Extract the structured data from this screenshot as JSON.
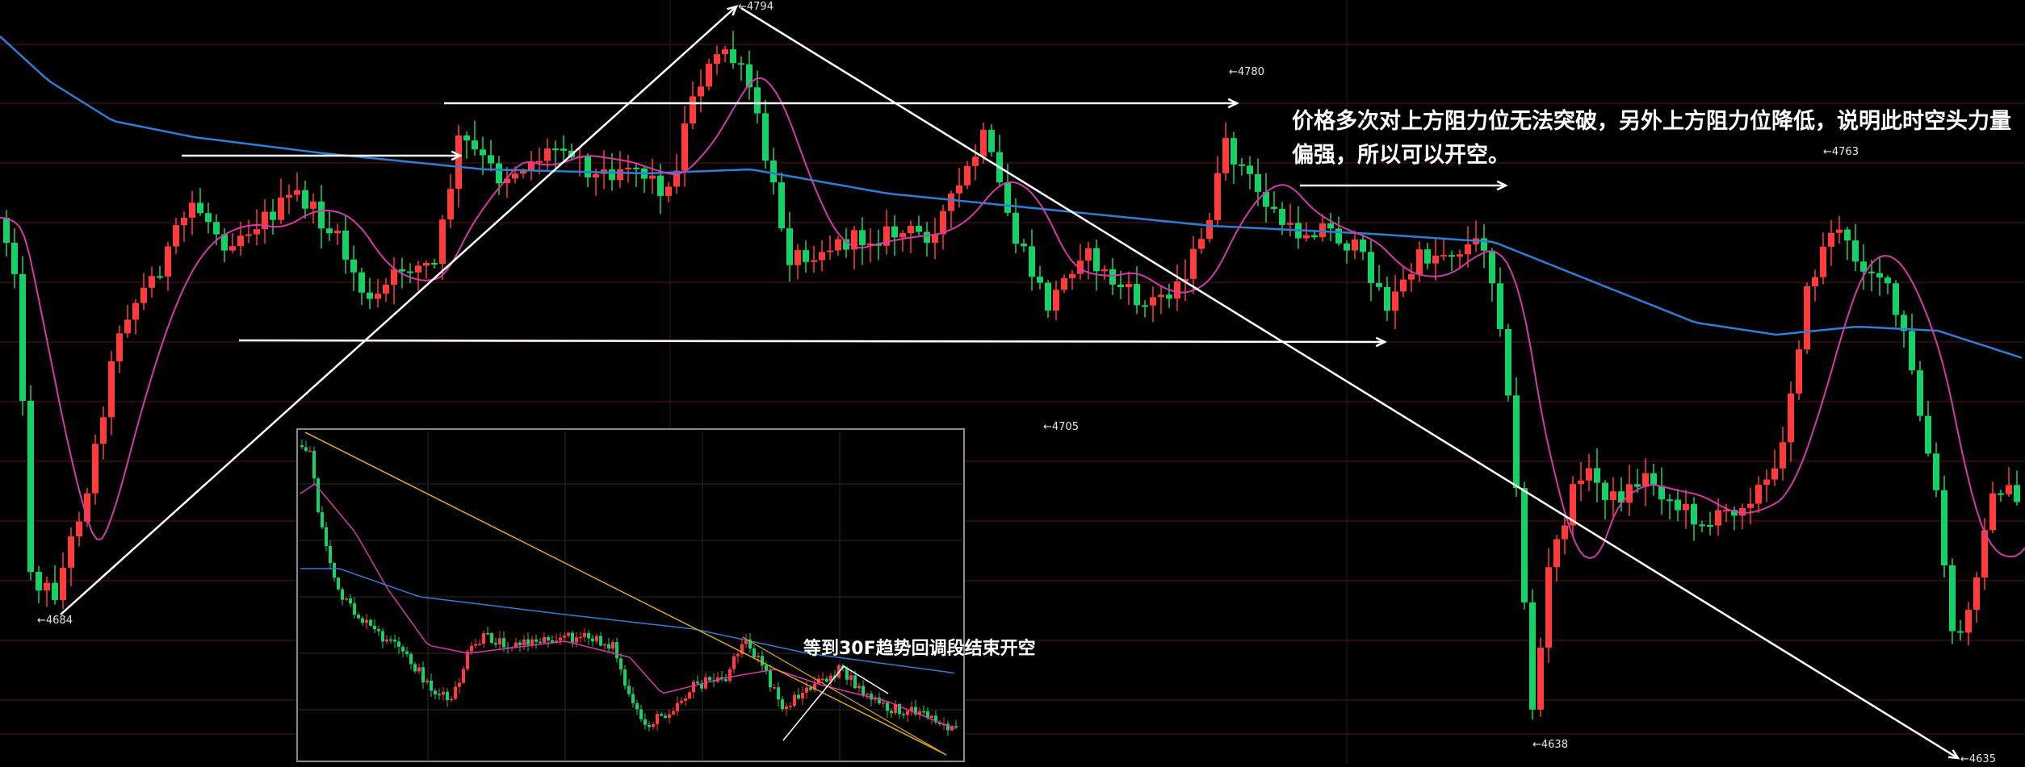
{
  "chart_data": {
    "type": "candlestick",
    "price_labels": [
      {
        "id": "p4684",
        "text": "←4684"
      },
      {
        "id": "p4794",
        "text": "←4794"
      },
      {
        "id": "p4705",
        "text": "←4705"
      },
      {
        "id": "p4780",
        "text": "←4780"
      },
      {
        "id": "p4763",
        "text": "←4763"
      },
      {
        "id": "p4638",
        "text": "←4638"
      },
      {
        "id": "p4635",
        "text": "←4635"
      }
    ],
    "colors": {
      "background": "#000000",
      "up": "#ff3b3b",
      "down": "#16d266",
      "ma_fast": "#d13aa8",
      "ma_slow": "#2b7fd6",
      "grid": "#5a1520",
      "annotation": "#ffffff",
      "inset_trend": "#e0a81a"
    },
    "annotations": {
      "main_note": "价格多次对上方阻力位无法突破，另外上方阻力位降低，说明此时空头力量偏强，所以可以开空。",
      "inset_note": "等到30F趋势回调段结束开空"
    }
  }
}
